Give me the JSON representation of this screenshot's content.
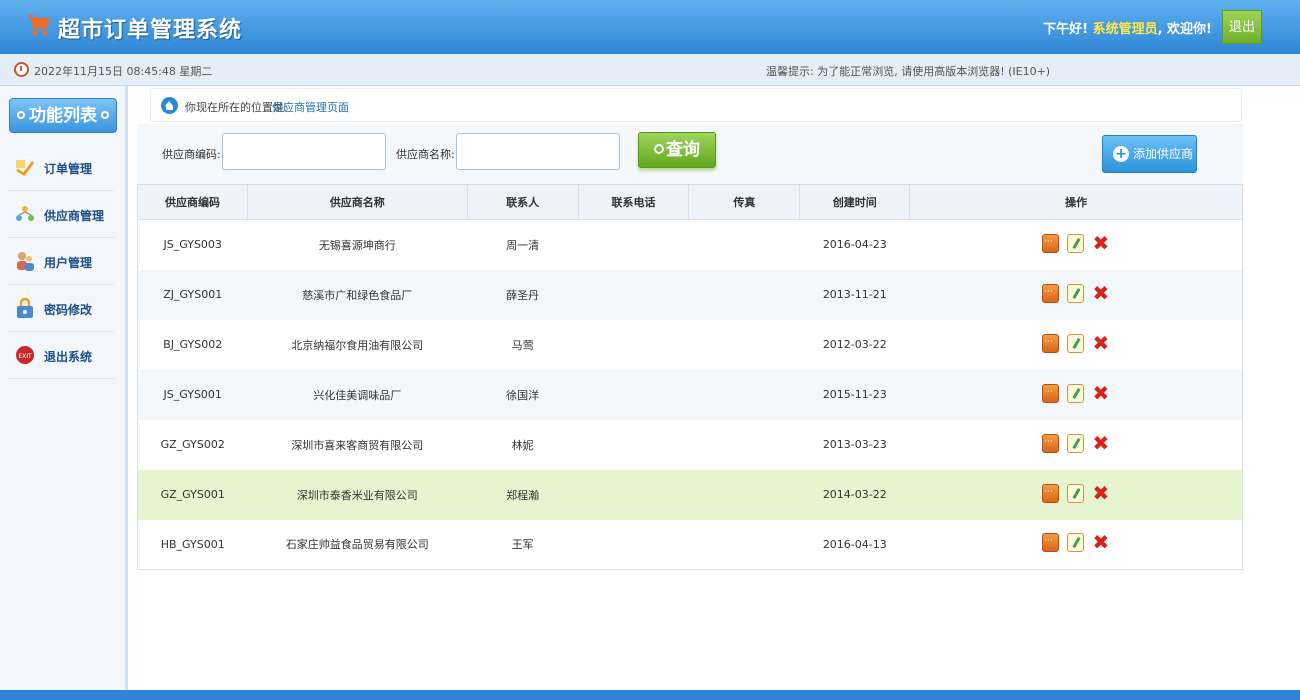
{
  "header": {
    "title": "超市订单管理系统",
    "greeting_prefix": "下午好!",
    "username": "系统管理员",
    "greeting_suffix": ", 欢迎你!",
    "logout_label": "退出"
  },
  "subbar": {
    "datetime": "2022年11月15日 08:45:48 星期二",
    "tip": "温馨提示: 为了能正常浏览, 请使用高版本浏览器! (IE10+)"
  },
  "sidebar": {
    "title": "功能列表",
    "items": [
      {
        "label": "订单管理",
        "icon": "order-icon"
      },
      {
        "label": "供应商管理",
        "icon": "supplier-icon"
      },
      {
        "label": "用户管理",
        "icon": "users-icon"
      },
      {
        "label": "密码修改",
        "icon": "password-icon"
      },
      {
        "label": "退出系统",
        "icon": "exit-icon"
      }
    ]
  },
  "breadcrumb": {
    "prefix": "你现在所在的位置是:",
    "current": "供应商管理页面"
  },
  "search": {
    "code_label": "供应商编码:",
    "name_label": "供应商名称:",
    "code_value": "",
    "name_value": "",
    "query_label": "查询",
    "add_label": "添加供应商"
  },
  "table": {
    "headers": [
      "供应商编码",
      "供应商名称",
      "联系人",
      "联系电话",
      "传真",
      "创建时间",
      "操作"
    ],
    "rows": [
      {
        "code": "JS_GYS003",
        "name": "无锡喜源坤商行",
        "contact": "周一清",
        "phone": "",
        "fax": "",
        "created": "2016-04-23"
      },
      {
        "code": "ZJ_GYS001",
        "name": "慈溪市广和绿色食品厂",
        "contact": "薛圣丹",
        "phone": "",
        "fax": "",
        "created": "2013-11-21"
      },
      {
        "code": "BJ_GYS002",
        "name": "北京纳福尔食用油有限公司",
        "contact": "马莺",
        "phone": "",
        "fax": "",
        "created": "2012-03-22"
      },
      {
        "code": "JS_GYS001",
        "name": "兴化佳美调味品厂",
        "contact": "徐国洋",
        "phone": "",
        "fax": "",
        "created": "2015-11-23"
      },
      {
        "code": "GZ_GYS002",
        "name": "深圳市喜来客商贸有限公司",
        "contact": "林妮",
        "phone": "",
        "fax": "",
        "created": "2013-03-23"
      },
      {
        "code": "GZ_GYS001",
        "name": "深圳市泰香米业有限公司",
        "contact": "郑程瀚",
        "phone": "",
        "fax": "",
        "created": "2014-03-22"
      },
      {
        "code": "HB_GYS001",
        "name": "石家庄帅益食品贸易有限公司",
        "contact": "王军",
        "phone": "",
        "fax": "",
        "created": "2016-04-13"
      }
    ]
  }
}
